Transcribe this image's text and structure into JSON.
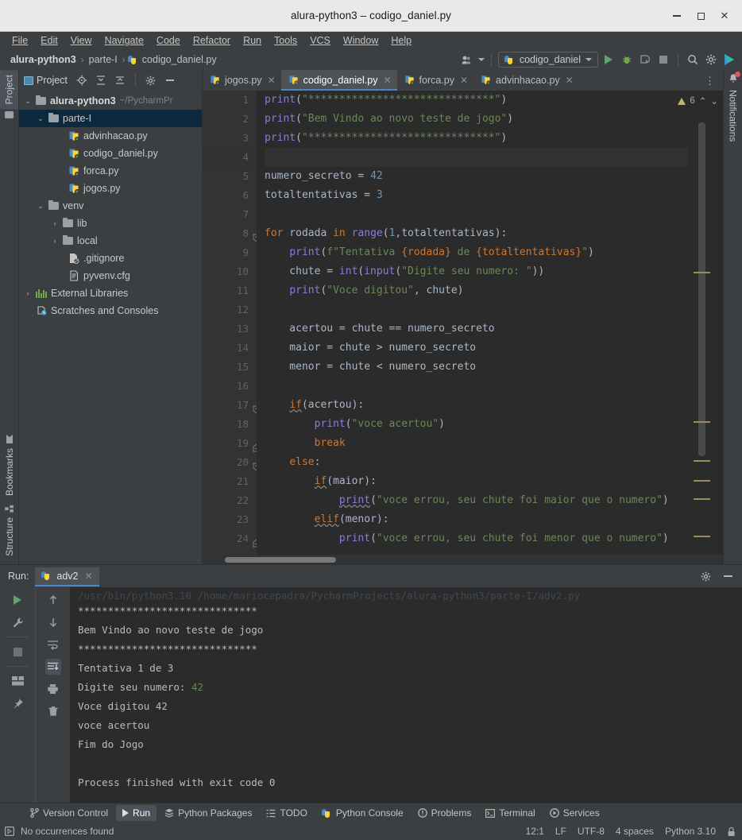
{
  "window": {
    "title": "alura-python3 – codigo_daniel.py",
    "minimize": "–",
    "maximize": "□",
    "close": "✕"
  },
  "menubar": {
    "items": [
      {
        "label": "File"
      },
      {
        "label": "Edit"
      },
      {
        "label": "View"
      },
      {
        "label": "Navigate"
      },
      {
        "label": "Code"
      },
      {
        "label": "Refactor"
      },
      {
        "label": "Run"
      },
      {
        "label": "Tools"
      },
      {
        "label": "VCS"
      },
      {
        "label": "Window"
      },
      {
        "label": "Help"
      }
    ]
  },
  "navbar": {
    "breadcrumbs": [
      "alura-python3",
      "parte-I",
      "codigo_daniel.py"
    ],
    "separator": "›",
    "run_config": "codigo_daniel",
    "icons": [
      "user-settings-icon",
      "run-icon",
      "debug-icon",
      "run-coverage-icon",
      "stop-icon",
      "search-icon",
      "settings-icon",
      "account-icon"
    ]
  },
  "left_stripe": {
    "top_tab": "Project",
    "bottom_tabs": [
      "Bookmarks",
      "Structure"
    ]
  },
  "project_pane": {
    "title": "Project",
    "header_icons": [
      "locate-icon",
      "expand-all-icon",
      "collapse-all-icon",
      "settings-icon",
      "hide-icon"
    ],
    "tree": [
      {
        "label": "alura-python3",
        "suffix": "~/PycharmPr",
        "depth": 0,
        "icon": "folder-icon",
        "chevron": "expanded",
        "bold": true,
        "selected": false
      },
      {
        "label": "parte-I",
        "suffix": "",
        "depth": 1,
        "icon": "folder-icon",
        "chevron": "expanded",
        "bold": false,
        "selected": true
      },
      {
        "label": "advinhacao.py",
        "suffix": "",
        "depth": 2,
        "icon": "python-file-icon",
        "chevron": "none",
        "bold": false,
        "selected": false
      },
      {
        "label": "codigo_daniel.py",
        "suffix": "",
        "depth": 2,
        "icon": "python-file-icon",
        "chevron": "none",
        "bold": false,
        "selected": false
      },
      {
        "label": "forca.py",
        "suffix": "",
        "depth": 2,
        "icon": "python-file-icon",
        "chevron": "none",
        "bold": false,
        "selected": false
      },
      {
        "label": "jogos.py",
        "suffix": "",
        "depth": 2,
        "icon": "python-file-icon",
        "chevron": "none",
        "bold": false,
        "selected": false
      },
      {
        "label": "venv",
        "suffix": "",
        "depth": 1,
        "icon": "folder-icon",
        "chevron": "expanded",
        "bold": false,
        "selected": false
      },
      {
        "label": "lib",
        "suffix": "",
        "depth": 2,
        "icon": "folder-icon",
        "chevron": "collapsed",
        "bold": false,
        "selected": false
      },
      {
        "label": "local",
        "suffix": "",
        "depth": 2,
        "icon": "folder-icon",
        "chevron": "collapsed",
        "bold": false,
        "selected": false
      },
      {
        "label": ".gitignore",
        "suffix": "",
        "depth": 2,
        "icon": "gitignore-icon",
        "chevron": "none",
        "bold": false,
        "selected": false
      },
      {
        "label": "pyvenv.cfg",
        "suffix": "",
        "depth": 2,
        "icon": "config-file-icon",
        "chevron": "none",
        "bold": false,
        "selected": false
      },
      {
        "label": "External Libraries",
        "suffix": "",
        "depth": 0,
        "icon": "libraries-icon",
        "chevron": "collapsed",
        "bold": false,
        "selected": false
      },
      {
        "label": "Scratches and Consoles",
        "suffix": "",
        "depth": 0,
        "icon": "scratches-icon",
        "chevron": "none",
        "bold": false,
        "selected": false
      }
    ]
  },
  "editor": {
    "tabs": [
      {
        "label": "jogos.py",
        "active": false
      },
      {
        "label": "codigo_daniel.py",
        "active": true
      },
      {
        "label": "forca.py",
        "active": false
      },
      {
        "label": "advinhacao.py",
        "active": false
      }
    ],
    "close_glyph": "✕",
    "kebab": "⋮",
    "inspection": {
      "warning_count": "6",
      "up": "⌃",
      "down": "⌄"
    },
    "first_visible_line": 1,
    "lines": [
      {
        "n": 1,
        "tokens": [
          {
            "t": "print",
            "c": "fn"
          },
          {
            "t": "(",
            "c": "p"
          },
          {
            "t": "\"******************************\"",
            "c": "s"
          },
          {
            "t": ")",
            "c": "p"
          }
        ]
      },
      {
        "n": 2,
        "tokens": [
          {
            "t": "print",
            "c": "fn"
          },
          {
            "t": "(",
            "c": "p"
          },
          {
            "t": "\"Bem Vindo ao novo teste de jogo\"",
            "c": "s"
          },
          {
            "t": ")",
            "c": "p"
          }
        ]
      },
      {
        "n": 3,
        "tokens": [
          {
            "t": "print",
            "c": "fn"
          },
          {
            "t": "(",
            "c": "p"
          },
          {
            "t": "\"******************************\"",
            "c": "s"
          },
          {
            "t": ")",
            "c": "p"
          }
        ]
      },
      {
        "n": 4,
        "tokens": [],
        "current": true
      },
      {
        "n": 5,
        "tokens": [
          {
            "t": "numero_secreto = ",
            "c": "p"
          },
          {
            "t": "42",
            "c": "n"
          }
        ]
      },
      {
        "n": 6,
        "tokens": [
          {
            "t": "totaltentativas = ",
            "c": "p"
          },
          {
            "t": "3",
            "c": "n"
          }
        ]
      },
      {
        "n": 7,
        "tokens": []
      },
      {
        "n": 8,
        "tokens": [
          {
            "t": "for",
            "c": "k"
          },
          {
            "t": " rodada ",
            "c": "p"
          },
          {
            "t": "in",
            "c": "k"
          },
          {
            "t": " ",
            "c": "p"
          },
          {
            "t": "range",
            "c": "fn"
          },
          {
            "t": "(",
            "c": "p"
          },
          {
            "t": "1",
            "c": "n"
          },
          {
            "t": ",totaltentativas):",
            "c": "p"
          }
        ],
        "fold": "open"
      },
      {
        "n": 9,
        "tokens": [
          {
            "t": "    ",
            "c": "p"
          },
          {
            "t": "print",
            "c": "fn"
          },
          {
            "t": "(",
            "c": "p"
          },
          {
            "t": "f\"Tentativa ",
            "c": "s"
          },
          {
            "t": "{rodada}",
            "c": "fb"
          },
          {
            "t": " de ",
            "c": "s"
          },
          {
            "t": "{totaltentativas}",
            "c": "fb"
          },
          {
            "t": "\"",
            "c": "s"
          },
          {
            "t": ")",
            "c": "p"
          }
        ]
      },
      {
        "n": 10,
        "tokens": [
          {
            "t": "    chute = ",
            "c": "p"
          },
          {
            "t": "int",
            "c": "fn"
          },
          {
            "t": "(",
            "c": "p"
          },
          {
            "t": "input",
            "c": "fn"
          },
          {
            "t": "(",
            "c": "p"
          },
          {
            "t": "\"Digite seu numero: \"",
            "c": "s"
          },
          {
            "t": "))",
            "c": "p"
          }
        ]
      },
      {
        "n": 11,
        "tokens": [
          {
            "t": "    ",
            "c": "p"
          },
          {
            "t": "print",
            "c": "fn"
          },
          {
            "t": "(",
            "c": "p"
          },
          {
            "t": "\"Voce digitou\"",
            "c": "s"
          },
          {
            "t": ", chute)",
            "c": "p"
          }
        ]
      },
      {
        "n": 12,
        "tokens": []
      },
      {
        "n": 13,
        "tokens": [
          {
            "t": "    acertou = chute == numero_secreto",
            "c": "p"
          }
        ]
      },
      {
        "n": 14,
        "tokens": [
          {
            "t": "    maior = chute > numero_secreto",
            "c": "p"
          }
        ]
      },
      {
        "n": 15,
        "tokens": [
          {
            "t": "    menor = chute < numero_secreto",
            "c": "p"
          }
        ]
      },
      {
        "n": 16,
        "tokens": []
      },
      {
        "n": 17,
        "tokens": [
          {
            "t": "    ",
            "c": "p"
          },
          {
            "t": "if",
            "c": "k warn"
          },
          {
            "t": "(acertou):",
            "c": "p"
          }
        ],
        "fold": "open"
      },
      {
        "n": 18,
        "tokens": [
          {
            "t": "        ",
            "c": "p"
          },
          {
            "t": "print",
            "c": "fn"
          },
          {
            "t": "(",
            "c": "p"
          },
          {
            "t": "\"voce acertou\"",
            "c": "s"
          },
          {
            "t": ")",
            "c": "p"
          }
        ]
      },
      {
        "n": 19,
        "tokens": [
          {
            "t": "        ",
            "c": "p"
          },
          {
            "t": "break",
            "c": "k"
          }
        ],
        "fold": "end"
      },
      {
        "n": 20,
        "tokens": [
          {
            "t": "    ",
            "c": "p"
          },
          {
            "t": "else",
            "c": "k"
          },
          {
            "t": ":",
            "c": "p"
          }
        ],
        "fold": "open"
      },
      {
        "n": 21,
        "tokens": [
          {
            "t": "        ",
            "c": "p"
          },
          {
            "t": "if",
            "c": "k warn"
          },
          {
            "t": "(maior):",
            "c": "p"
          }
        ]
      },
      {
        "n": 22,
        "tokens": [
          {
            "t": "            ",
            "c": "p"
          },
          {
            "t": "print",
            "c": "fn warn"
          },
          {
            "t": "(",
            "c": "p"
          },
          {
            "t": "\"voce errou, seu chute foi maior que o numero\"",
            "c": "s"
          },
          {
            "t": ")",
            "c": "p"
          }
        ]
      },
      {
        "n": 23,
        "tokens": [
          {
            "t": "        ",
            "c": "p"
          },
          {
            "t": "elif",
            "c": "k warn"
          },
          {
            "t": "(menor):",
            "c": "p"
          }
        ]
      },
      {
        "n": 24,
        "tokens": [
          {
            "t": "            ",
            "c": "p"
          },
          {
            "t": "print",
            "c": "fn"
          },
          {
            "t": "(",
            "c": "p"
          },
          {
            "t": "\"voce errou, seu chute foi menor que o numero\"",
            "c": "s"
          },
          {
            "t": ")",
            "c": "p"
          }
        ],
        "fold": "end"
      }
    ]
  },
  "run_window": {
    "label": "Run:",
    "tab": "adv2",
    "tab_close": "✕",
    "settings_icon": "gear-icon",
    "hide_icon": "minimize-icon",
    "side_icons_left": [
      "rerun-icon",
      "settings-wrench-icon",
      "stop-icon",
      "layout-icon",
      "pin-icon"
    ],
    "side_icons_right": [
      "up-icon",
      "down-icon",
      "soft-wrap-icon",
      "scroll-to-end-icon",
      "print-icon",
      "trash-icon"
    ],
    "output": [
      {
        "text": "/usr/bin/python3.10 /home/mariocepadra/PycharmProjects/alura-python3/parte-I/adv2.py",
        "clipped": true
      },
      {
        "text": "******************************"
      },
      {
        "text": "Bem Vindo ao novo teste de jogo"
      },
      {
        "text": "******************************"
      },
      {
        "text": "Tentativa 1 de 3"
      },
      {
        "text": "Digite seu numero: ",
        "input": "42"
      },
      {
        "text": "Voce digitou 42"
      },
      {
        "text": "voce acertou"
      },
      {
        "text": "Fim do Jogo"
      },
      {
        "text": ""
      },
      {
        "text": "Process finished with exit code 0"
      }
    ]
  },
  "bottom_toolbar": {
    "items": [
      {
        "label": "Version Control",
        "icon": "branch-icon",
        "selected": false
      },
      {
        "label": "Run",
        "icon": "run-icon",
        "selected": true
      },
      {
        "label": "Python Packages",
        "icon": "packages-icon",
        "selected": false
      },
      {
        "label": "TODO",
        "icon": "todo-icon",
        "selected": false
      },
      {
        "label": "Python Console",
        "icon": "python-icon",
        "selected": false
      },
      {
        "label": "Problems",
        "icon": "problems-icon",
        "selected": false
      },
      {
        "label": "Terminal",
        "icon": "terminal-icon",
        "selected": false
      },
      {
        "label": "Services",
        "icon": "services-icon",
        "selected": false
      }
    ]
  },
  "statusbar": {
    "message": "No occurrences found",
    "caret": "12:1",
    "line_sep": "LF",
    "encoding": "UTF-8",
    "indent": "4 spaces",
    "interpreter": "Python 3.10",
    "lock_icon": "lock-icon"
  },
  "notifications": {
    "label": "Notifications"
  },
  "colors": {
    "accent_blue": "#4a88c7",
    "selection": "#0d293e",
    "editor_bg": "#2b2b2b",
    "panel_bg": "#3c3f41",
    "green_run": "#59a869",
    "string_green": "#6a8759",
    "keyword_orange": "#cc7832",
    "number_blue": "#6897bb"
  }
}
